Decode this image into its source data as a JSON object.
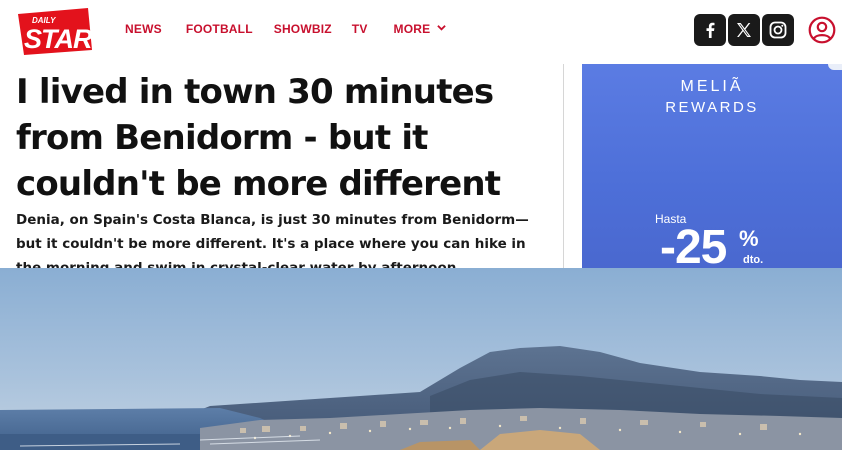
{
  "header": {
    "logo_small": "DAILY",
    "logo_big": "STAR",
    "nav": [
      {
        "label": "NEWS"
      },
      {
        "label": "FOOTBALL"
      },
      {
        "label": "SHOWBIZ"
      },
      {
        "label": "TV"
      },
      {
        "label": "MORE"
      }
    ],
    "social": [
      "facebook-icon",
      "x-icon",
      "instagram-icon"
    ],
    "brand_color": "#c8102e"
  },
  "article": {
    "headline": "I lived in town 30 minutes from Benidorm - but it couldn't be more different",
    "standfirst": "Denia, on Spain's Costa Blanca, is just 30 minutes from Benidorm—but it couldn't be more different. It's a place where you can hike in the morning and swim in crystal-clear water by afternoon"
  },
  "ad": {
    "brand": "MELIÃ",
    "subtitle": "REWARDS",
    "hasta": "Hasta",
    "discount": "-25",
    "percent": "%",
    "dto": "dto.",
    "background": "#5b7ce3"
  }
}
